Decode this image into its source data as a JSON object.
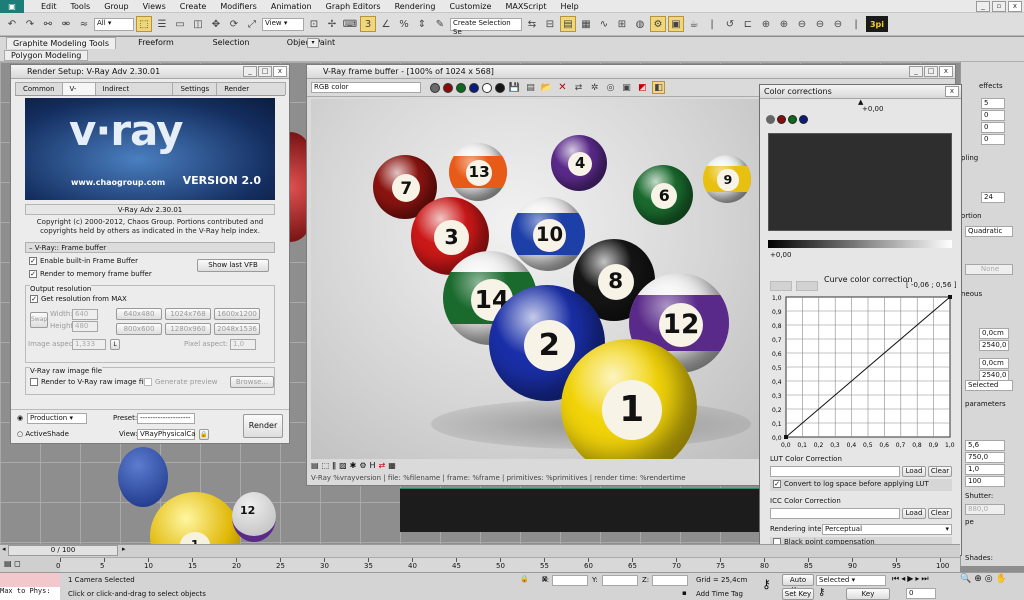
{
  "menu": [
    "Edit",
    "Tools",
    "Group",
    "Views",
    "Create",
    "Modifiers",
    "Animation",
    "Graph Editors",
    "Rendering",
    "Customize",
    "MAXScript",
    "Help"
  ],
  "toolbar": {
    "filter": "All",
    "ref_coord": "View",
    "selection_set": "Create Selection Se",
    "badge": "3pi"
  },
  "ribbon": {
    "tabs": [
      "Graphite Modeling Tools",
      "Freeform",
      "Selection",
      "Object Paint"
    ],
    "sub": "Polygon Modeling"
  },
  "render_setup": {
    "title": "Render Setup: V-Ray Adv 2.30.01",
    "tabs": [
      "Common",
      "V-Ray",
      "Indirect illumination",
      "Settings",
      "Render Elements"
    ],
    "logo_text": "v·ray",
    "logo_url": "www.chaogroup.com",
    "logo_version": "VERSION 2.0",
    "version": "V-Ray Adv 2.30.01",
    "copyright": "Copyright (c) 2000-2012, Chaos Group. Portions contributed and copyrights held by others as indicated in the V-Ray help index.",
    "rollout_fb": "V-Ray:: Frame buffer",
    "enable_vfb": "Enable built-in Frame Buffer",
    "render_memory": "Render to memory frame buffer",
    "show_vfb": "Show last VFB",
    "output_res": "Output resolution",
    "get_res": "Get resolution from MAX",
    "swap": "Swap",
    "width_lbl": "Width:",
    "height_lbl": "Height:",
    "width_val": "640",
    "height_val": "480",
    "presets": [
      "640x480",
      "1024x768",
      "1600x1200",
      "800x600",
      "1280x960",
      "2048x1536"
    ],
    "aspect_lbl": "Image aspect:",
    "aspect_val": "1,333",
    "l": "L",
    "pix_lbl": "Pixel aspect:",
    "pix_val": "1,0",
    "raw_group": "V-Ray raw image file",
    "raw_chk": "Render to V-Ray raw image file",
    "gen_preview": "Generate preview",
    "browse": "Browse...",
    "production": "Production",
    "activeshade": "ActiveShade",
    "preset_lbl": "Preset:",
    "preset_val": "--------------------",
    "view_lbl": "View:",
    "view_val": "VRayPhysicalCa",
    "render_btn": "Render"
  },
  "vfb": {
    "title": "V-Ray frame buffer - [100% of 1024 x 568]",
    "channel": "RGB color",
    "status": "V-Ray %vrayversion | file: %filename | frame: %frame | primitives: %primitives | render time: %rendertime"
  },
  "balls": [
    {
      "n": "13",
      "c": "#e85a18",
      "stripe": true
    },
    {
      "n": "4",
      "c": "#5a2a8a",
      "stripe": false
    },
    {
      "n": "7",
      "c": "#8a1410",
      "stripe": false
    },
    {
      "n": "3",
      "c": "#cc1818",
      "stripe": false
    },
    {
      "n": "10",
      "c": "#1d3fa8",
      "stripe": true
    },
    {
      "n": "6",
      "c": "#1a6a2e",
      "stripe": false
    },
    {
      "n": "9",
      "c": "#e8c010",
      "stripe": true
    },
    {
      "n": "14",
      "c": "#1a6a2e",
      "stripe": true
    },
    {
      "n": "8",
      "c": "#151515",
      "stripe": false
    },
    {
      "n": "2",
      "c": "#1a2fa8",
      "stripe": false
    },
    {
      "n": "12",
      "c": "#5a2a8a",
      "stripe": true
    },
    {
      "n": "1",
      "c": "#f2d40a",
      "stripe": false
    }
  ],
  "cc": {
    "title": "Color corrections",
    "top_val": "+0,00",
    "bottom_val": "+0,00",
    "curve_title": "Curve color correction",
    "curve_coord": "[ -0,06 ; 0,56 ]",
    "y_ticks": [
      "1,0",
      "0,9",
      "0,8",
      "0,7",
      "0,6",
      "0,5",
      "0,4",
      "0,3",
      "0,2",
      "0,1",
      "0,0"
    ],
    "x_ticks": [
      "0,0",
      "0,1",
      "0,2",
      "0,3",
      "0,4",
      "0,5",
      "0,6",
      "0,7",
      "0,8",
      "0,9",
      "1,0"
    ],
    "lut_title": "LUT Color Correction",
    "load": "Load",
    "clear": "Clear",
    "lut_chk": "Convert to log space before applying LUT",
    "icc_title": "ICC Color Correction",
    "intent_lbl": "Rendering intent",
    "intent_val": "Perceptual",
    "bpc": "Black point compensation"
  },
  "right_panel": {
    "effects": "effects",
    "values": [
      "5",
      "0",
      "0",
      "0"
    ],
    "pling": "pling",
    "num24": "24",
    "ortion": "ortion",
    "quadratic": "Quadratic",
    "none": "None",
    "neous": "neous",
    "cm1": "0,0cm",
    "v2540": "2540,0",
    "cm2": "0,0cm",
    "v2540b": "2540,0",
    "selected": "Selected",
    "parameters": "parameters",
    "v56": "5,6",
    "v750": "750,0",
    "v10": "1,0",
    "v100": "100",
    "shutter": "Shutter:",
    "v880": "880,0",
    "pe": "pe",
    "shades": "Shades:"
  },
  "timeline": {
    "frame": "0 / 100",
    "ticks": [
      "0",
      "5",
      "10",
      "15",
      "20",
      "25",
      "30",
      "35",
      "40",
      "45",
      "50",
      "55",
      "60",
      "65",
      "70",
      "75",
      "80",
      "85",
      "90",
      "95",
      "100"
    ]
  },
  "status": {
    "maxscript": "Max to Phys:",
    "selected": "1 Camera Selected",
    "hint": "Click or click-and-drag to select objects",
    "x": "X:",
    "y": "Y:",
    "z": "Z:",
    "grid": "Grid = 25,4cm",
    "add_tag": "Add Time Tag",
    "auto_key": "Auto Key",
    "set_key": "Set Key",
    "sel_val": "Selected",
    "key_filters": "Key Filters...",
    "frame_val": "0"
  },
  "colors": {
    "accent": "#f0d77a",
    "vray_blue": "#1c3d7a",
    "titlebar_blue": "#0a6aa8"
  }
}
